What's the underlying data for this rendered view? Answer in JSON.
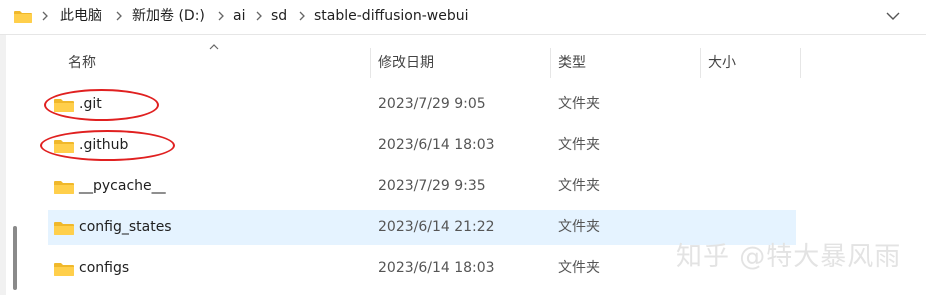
{
  "breadcrumb": {
    "items": [
      "此电脑",
      "新加卷 (D:)",
      "ai",
      "sd",
      "stable-diffusion-webui"
    ]
  },
  "columns": {
    "name": "名称",
    "date": "修改日期",
    "type": "类型",
    "size": "大小"
  },
  "rows": [
    {
      "name": ".git",
      "date": "2023/7/29 9:05",
      "type": "文件夹",
      "size": ""
    },
    {
      "name": ".github",
      "date": "2023/6/14 18:03",
      "type": "文件夹",
      "size": ""
    },
    {
      "name": "__pycache__",
      "date": "2023/7/29 9:35",
      "type": "文件夹",
      "size": ""
    },
    {
      "name": "config_states",
      "date": "2023/6/14 21:22",
      "type": "文件夹",
      "size": ""
    },
    {
      "name": "configs",
      "date": "2023/6/14 18:03",
      "type": "文件夹",
      "size": ""
    }
  ],
  "selected_row": "config_states",
  "annotations": [
    ".git",
    ".github"
  ],
  "watermark": "知乎 @特大暴风雨",
  "colors": {
    "folder": "#ffcf4b",
    "selection": "#e5f3ff",
    "annotation": "#e02020"
  },
  "icons": {
    "address_folder": "folder-icon",
    "separator": "chevron-right-icon",
    "dropdown": "chevron-down-icon",
    "sort": "sort-up-icon",
    "row_folder": "folder-icon"
  }
}
